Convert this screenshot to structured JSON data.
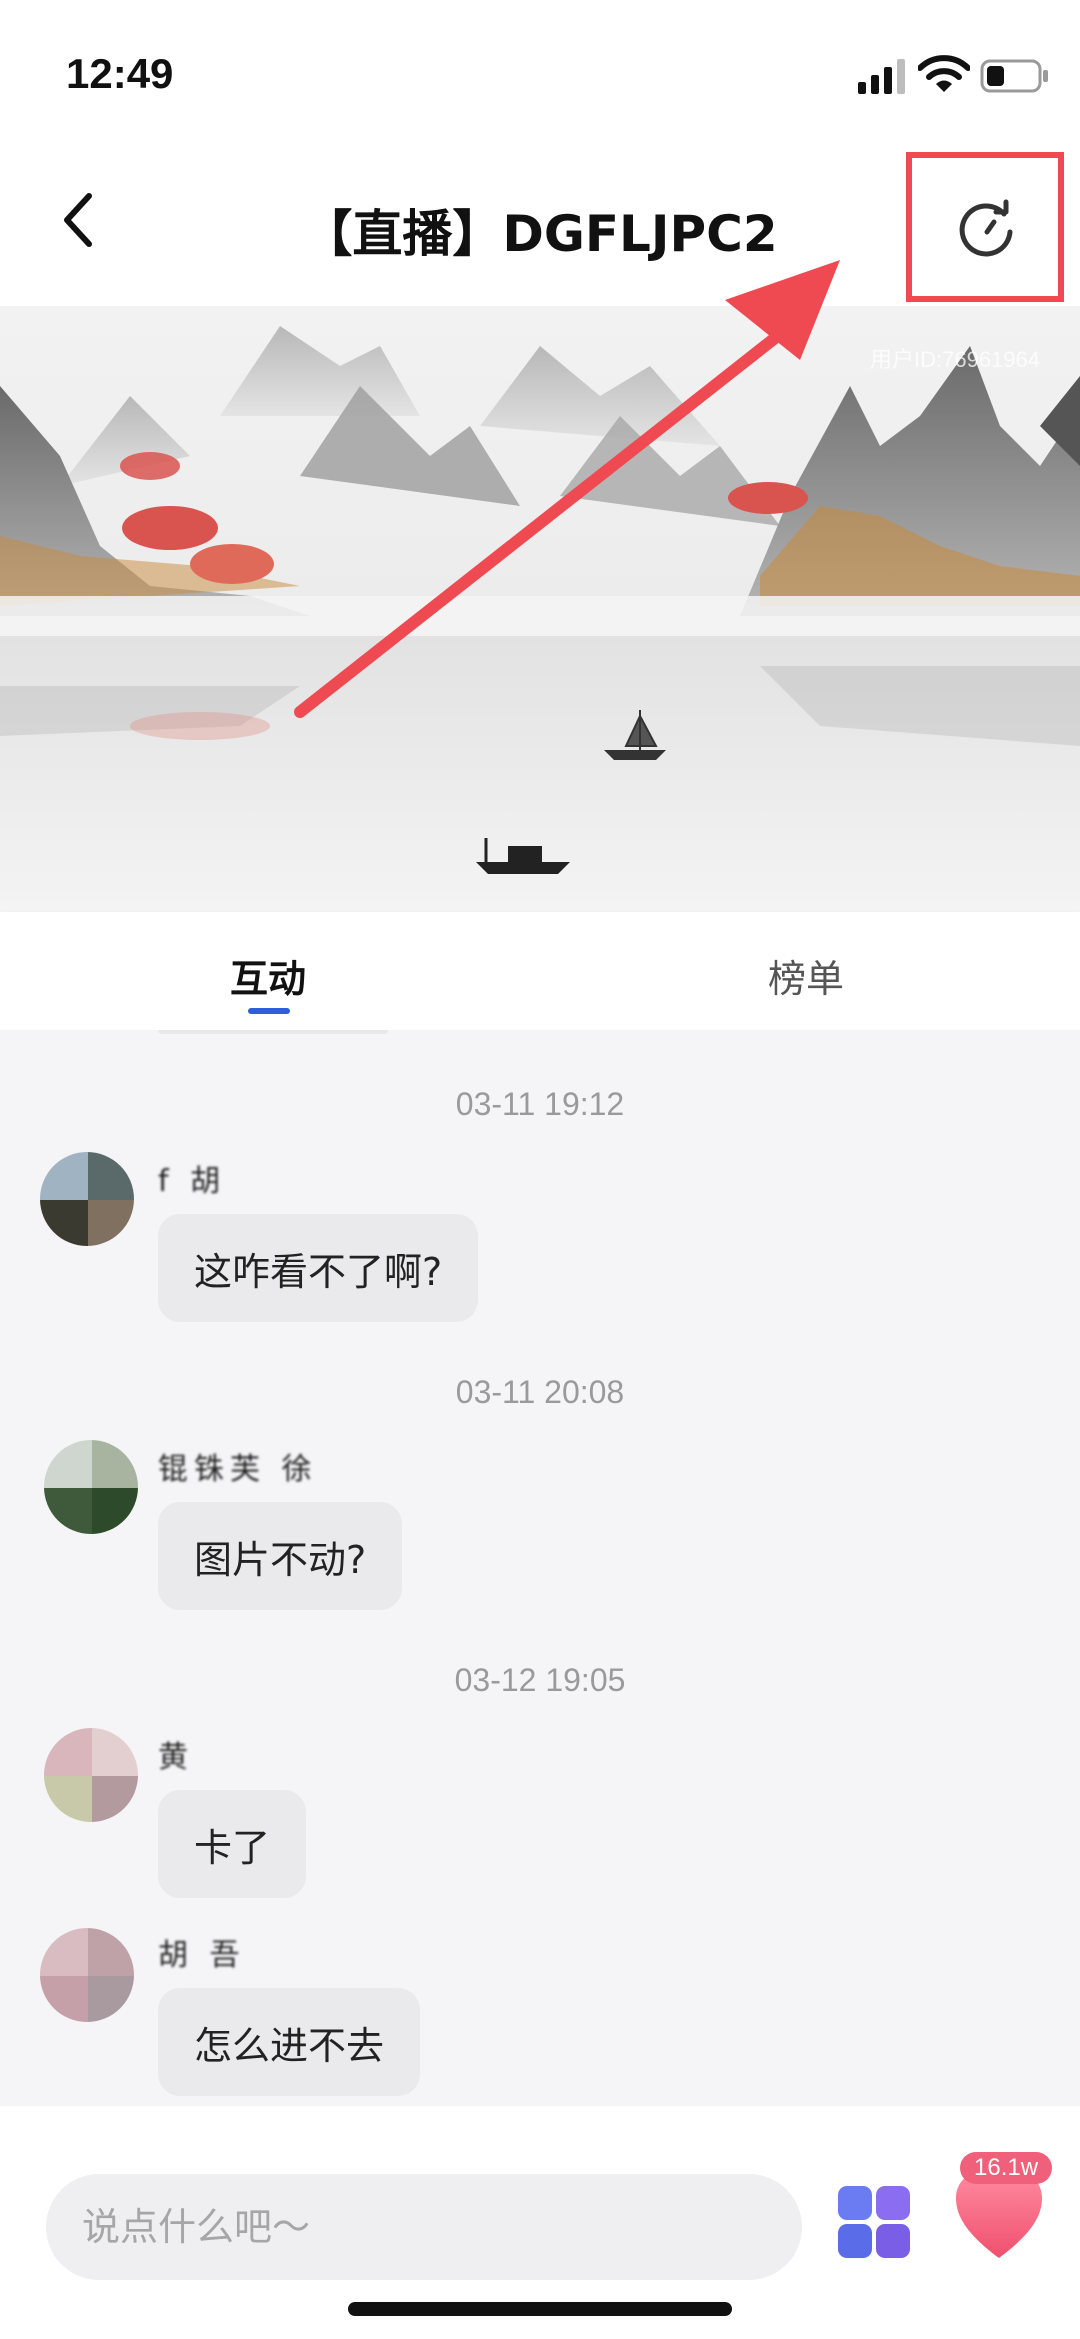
{
  "status_bar": {
    "time": "12:49"
  },
  "nav": {
    "title": "【直播】DGFLJPC2"
  },
  "video": {
    "watermark": "用户ID:76961964"
  },
  "tabs": [
    {
      "label": "互动",
      "active": true
    },
    {
      "label": "榜单",
      "active": false
    }
  ],
  "chat": {
    "messages": [
      {
        "timestamp": "03-11 19:12",
        "username": "f 胡",
        "text": "这咋看不了啊?"
      },
      {
        "timestamp": "03-11 20:08",
        "username": "锟铢芙 徐 ",
        "text": "图片不动?"
      },
      {
        "timestamp": "03-12 19:05",
        "username": "黄 ",
        "text": "卡了"
      },
      {
        "timestamp": "",
        "username": "胡 吾 ",
        "text": "怎么进不去"
      }
    ]
  },
  "input": {
    "placeholder": "说点什么吧～"
  },
  "like": {
    "count": "16.1w"
  },
  "colors": {
    "accent": "#2d5fd8",
    "annotation": "#ef4a52",
    "like": "#f0607a"
  }
}
